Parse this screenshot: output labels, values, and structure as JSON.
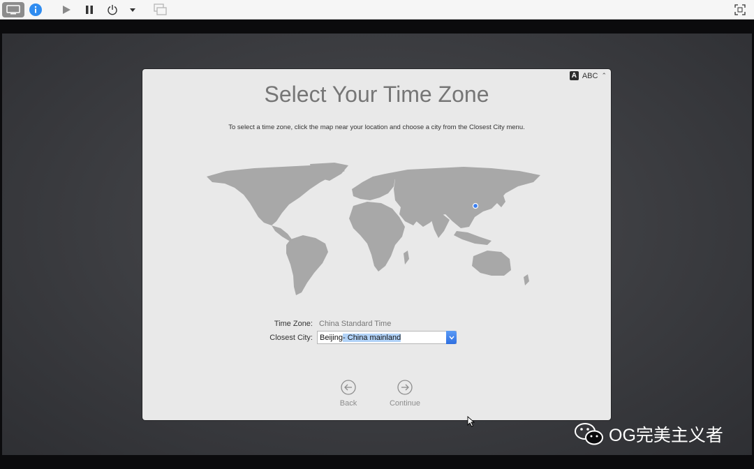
{
  "toolbar": {
    "buttons": [
      {
        "icon": "display-icon"
      },
      {
        "icon": "info-icon"
      },
      {
        "icon": "play-icon"
      },
      {
        "icon": "pause-icon"
      },
      {
        "icon": "power-icon"
      },
      {
        "icon": "dropdown-arrow-icon"
      },
      {
        "icon": "snapshot-icon"
      },
      {
        "icon": "fullscreen-icon"
      }
    ]
  },
  "input_source": {
    "badge": "A",
    "label": "ABC"
  },
  "page": {
    "title": "Select Your Time Zone",
    "subtitle": "To select a time zone, click the map near your location and choose a city from the Closest City menu."
  },
  "timezone": {
    "tz_label": "Time Zone:",
    "tz_value": "China Standard Time",
    "city_label": "Closest City:",
    "city_value_plain": "Beijing",
    "city_value_selected": " - China mainland"
  },
  "navigation": {
    "back": "Back",
    "continue": "Continue"
  },
  "watermark": {
    "text": "OG完美主义者"
  },
  "colors": {
    "accent": "#3b7ff0",
    "window_bg": "#e9e9e9",
    "map_land": "#a8a8a8",
    "selection": "#b2d3f8"
  }
}
